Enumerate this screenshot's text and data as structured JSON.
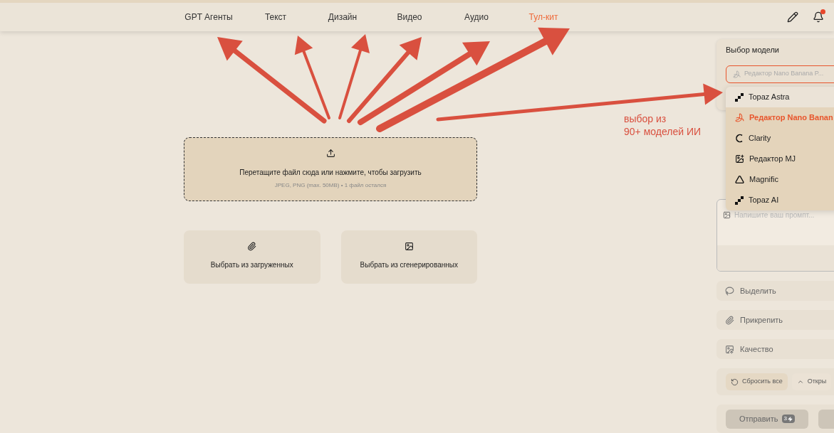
{
  "nav": {
    "items": [
      {
        "label": "GPT Агенты",
        "selected": false
      },
      {
        "label": "Текст",
        "selected": false
      },
      {
        "label": "Дизайн",
        "selected": false
      },
      {
        "label": "Видео",
        "selected": false
      },
      {
        "label": "Аудио",
        "selected": false
      },
      {
        "label": "Тул-кит",
        "selected": true
      }
    ],
    "notification_dot": true
  },
  "upload": {
    "title": "Перетащите файл сюда или нажмите, чтобы загрузить",
    "hint": "JPEG, PNG (max. 50MB) • 1 файл остался"
  },
  "sources": [
    {
      "kind": "uploaded",
      "label": "Выбрать из загруженных"
    },
    {
      "kind": "generated",
      "label": "Выбрать из сгенерированных"
    }
  ],
  "annotation": {
    "line1": "выбор из",
    "line2": "90+ моделей ИИ"
  },
  "panel": {
    "model_label": "Выбор модели",
    "model_value": "Редактор Nano Banana P...",
    "models": [
      {
        "kind": "topaz",
        "label": "Topaz Astra",
        "selected": false
      },
      {
        "kind": "banana",
        "label": "Редактор Nano Banan",
        "selected": true
      },
      {
        "kind": "clarity",
        "label": "Clarity",
        "selected": false
      },
      {
        "kind": "mj",
        "label": "Редактор MJ",
        "selected": false
      },
      {
        "kind": "magnific",
        "label": "Magnific",
        "selected": false
      },
      {
        "kind": "topaz",
        "label": "Topaz AI",
        "selected": false
      }
    ],
    "prompt_placeholder": "Напишите ваш промпт...",
    "options": [
      {
        "kind": "select",
        "label": "Выделить"
      },
      {
        "kind": "attach",
        "label": "Прикрепить"
      },
      {
        "kind": "quality",
        "label": "Качество"
      }
    ],
    "reset": "Сбросить все",
    "open": "Откры",
    "send": "Отправить",
    "cost": "3"
  }
}
